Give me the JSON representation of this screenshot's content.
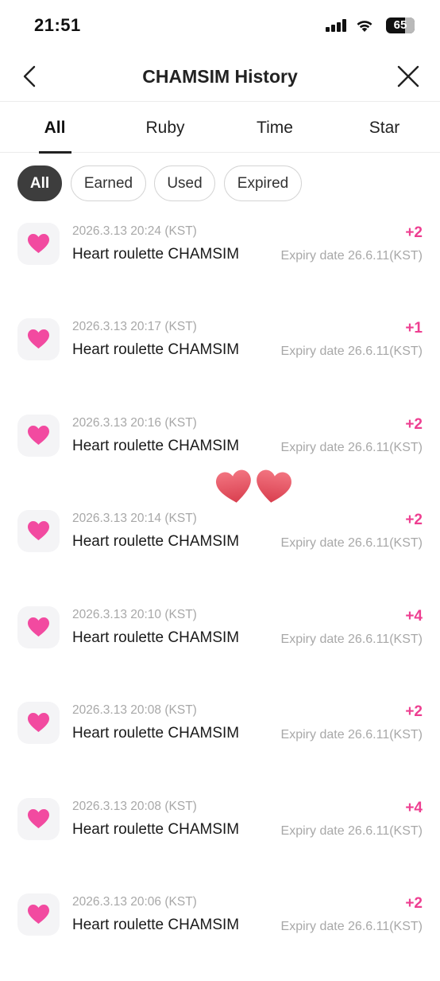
{
  "status_bar": {
    "time": "21:51",
    "battery": "65"
  },
  "header": {
    "title": "CHAMSIM History",
    "back_icon": "chevron-left-icon",
    "close_icon": "close-icon"
  },
  "tabs": [
    {
      "label": "All",
      "active": true
    },
    {
      "label": "Ruby",
      "active": false
    },
    {
      "label": "Time",
      "active": false
    },
    {
      "label": "Star",
      "active": false
    }
  ],
  "filters": [
    {
      "label": "All",
      "active": true
    },
    {
      "label": "Earned",
      "active": false
    },
    {
      "label": "Used",
      "active": false
    },
    {
      "label": "Expired",
      "active": false
    }
  ],
  "history": [
    {
      "date": "2026.3.13 20:24 (KST)",
      "title": "Heart roulette CHAMSIM",
      "amount": "+2",
      "expiry": "Expiry date 26.6.11(KST)"
    },
    {
      "date": "2026.3.13 20:17 (KST)",
      "title": "Heart roulette CHAMSIM",
      "amount": "+1",
      "expiry": "Expiry date 26.6.11(KST)"
    },
    {
      "date": "2026.3.13 20:16 (KST)",
      "title": "Heart roulette CHAMSIM",
      "amount": "+2",
      "expiry": "Expiry date 26.6.11(KST)"
    },
    {
      "date": "2026.3.13 20:14 (KST)",
      "title": "Heart roulette CHAMSIM",
      "amount": "+2",
      "expiry": "Expiry date 26.6.11(KST)"
    },
    {
      "date": "2026.3.13 20:10 (KST)",
      "title": "Heart roulette CHAMSIM",
      "amount": "+4",
      "expiry": "Expiry date 26.6.11(KST)"
    },
    {
      "date": "2026.3.13 20:08 (KST)",
      "title": "Heart roulette CHAMSIM",
      "amount": "+2",
      "expiry": "Expiry date 26.6.11(KST)"
    },
    {
      "date": "2026.3.13 20:08 (KST)",
      "title": "Heart roulette CHAMSIM",
      "amount": "+4",
      "expiry": "Expiry date 26.6.11(KST)"
    },
    {
      "date": "2026.3.13 20:06 (KST)",
      "title": "Heart roulette CHAMSIM",
      "amount": "+2",
      "expiry": "Expiry date 26.6.11(KST)"
    }
  ],
  "colors": {
    "accent_pink": "#ee3f91",
    "heart_icon": "#f24aa0",
    "sticker_heart": "#e8525f"
  },
  "icons": {
    "item_icon": "heart-icon",
    "sticker": "double-heart-sticker"
  }
}
